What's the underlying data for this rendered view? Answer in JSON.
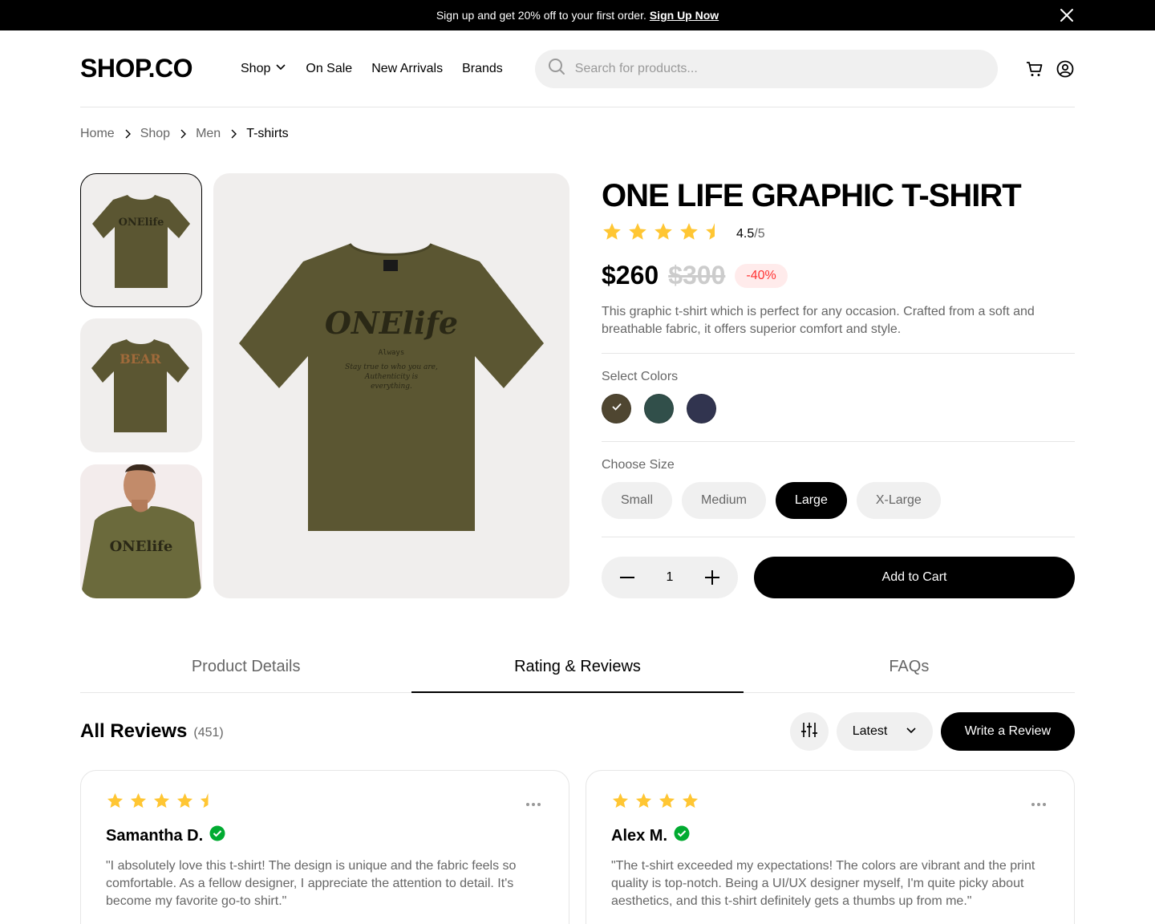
{
  "promo": {
    "text": "Sign up and get 20% off to your first order.",
    "link": "Sign Up Now"
  },
  "header": {
    "logo": "SHOP.CO",
    "nav": [
      "Shop",
      "On Sale",
      "New Arrivals",
      "Brands"
    ],
    "search_placeholder": "Search for products..."
  },
  "breadcrumb": [
    "Home",
    "Shop",
    "Men",
    "T-shirts"
  ],
  "product": {
    "title": "ONE LIFE GRAPHIC T-SHIRT",
    "rating": "4.5",
    "rating_den": "/5",
    "rating_value": 4.5,
    "price": "$260",
    "old_price": "$300",
    "discount": "-40%",
    "description": "This graphic t-shirt which is perfect for any occasion. Crafted from a soft and breathable fabric, it offers superior comfort and style.",
    "colors_label": "Select Colors",
    "colors": [
      "#4f4631",
      "#314f4a",
      "#31344f"
    ],
    "selected_color": 0,
    "size_label": "Choose Size",
    "sizes": [
      "Small",
      "Medium",
      "Large",
      "X-Large"
    ],
    "selected_size": 2,
    "quantity": "1",
    "add_to_cart": "Add to Cart",
    "shirt_color": "#5b5632"
  },
  "tabs": [
    "Product Details",
    "Rating & Reviews",
    "FAQs"
  ],
  "active_tab": 1,
  "reviews": {
    "title": "All Reviews",
    "count": "(451)",
    "sort": "Latest",
    "write": "Write a Review",
    "items": [
      {
        "rating": 4.5,
        "name": "Samantha D.",
        "text": "\"I absolutely love this t-shirt! The design is unique and the fabric feels so comfortable. As a fellow designer, I appreciate the attention to detail. It's become my favorite go-to shirt.\""
      },
      {
        "rating": 4,
        "name": "Alex M.",
        "text": "\"The t-shirt exceeded my expectations! The colors are vibrant and the print quality is top-notch. Being a UI/UX designer myself, I'm quite picky about aesthetics, and this t-shirt definitely gets a thumbs up from me.\""
      }
    ]
  },
  "icons": {
    "close": "close-icon",
    "chevron": "chevron-down-icon",
    "search": "search-icon",
    "cart": "cart-icon",
    "user": "user-icon",
    "star": "star-icon",
    "check": "check-icon",
    "verified": "verified-icon",
    "filter": "filter-icon",
    "more": "more-icon"
  },
  "colors": {
    "star": "#ffc633",
    "verified": "#01ab31",
    "discount_bg": "#ffebeb",
    "discount_text": "#ff3333"
  }
}
